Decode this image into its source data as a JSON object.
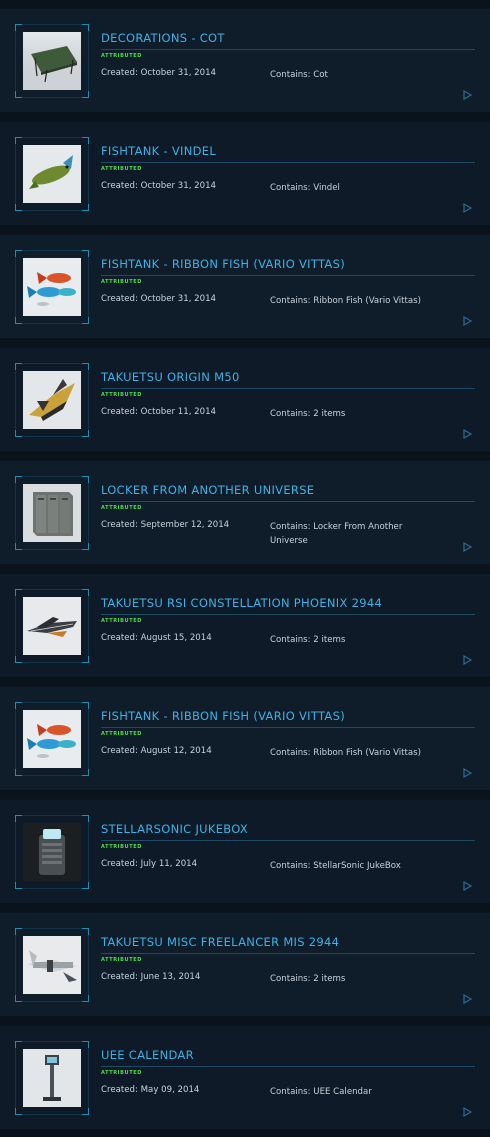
{
  "pledges": [
    {
      "title": "DECORATIONS - COT",
      "tag": "ATTRIBUTED",
      "created": "Created: October 31, 2014",
      "contains": "Contains: Cot",
      "thumb": "cot"
    },
    {
      "title": "FISHTANK - VINDEL",
      "tag": "ATTRIBUTED",
      "created": "Created: October 31, 2014",
      "contains": "Contains: Vindel",
      "thumb": "fish-green"
    },
    {
      "title": "FISHTANK - RIBBON FISH (VARIO VITTAS)",
      "tag": "ATTRIBUTED",
      "created": "Created: October 31, 2014",
      "contains": "Contains: Ribbon Fish (Vario Vittas)",
      "thumb": "fish-ribbon"
    },
    {
      "title": "TAKUETSU ORIGIN M50",
      "tag": "ATTRIBUTED",
      "created": "Created: October 11, 2014",
      "contains": "Contains: 2 items",
      "thumb": "ship-gold"
    },
    {
      "title": "LOCKER FROM ANOTHER UNIVERSE",
      "tag": "ATTRIBUTED",
      "created": "Created: September 12, 2014",
      "contains": "Contains: Locker From Another Universe",
      "thumb": "locker"
    },
    {
      "title": "TAKUETSU RSI CONSTELLATION PHOENIX 2944",
      "tag": "ATTRIBUTED",
      "created": "Created: August 15, 2014",
      "contains": "Contains: 2 items",
      "thumb": "ship-dark"
    },
    {
      "title": "FISHTANK - RIBBON FISH (VARIO VITTAS)",
      "tag": "ATTRIBUTED",
      "created": "Created: August 12, 2014",
      "contains": "Contains: Ribbon Fish (Vario Vittas)",
      "thumb": "fish-ribbon"
    },
    {
      "title": "STELLARSONIC JUKEBOX",
      "tag": "ATTRIBUTED",
      "created": "Created: July 11, 2014",
      "contains": "Contains: StellarSonic JukeBox",
      "thumb": "jukebox"
    },
    {
      "title": "TAKUETSU MISC FREELANCER MIS 2944",
      "tag": "ATTRIBUTED",
      "created": "Created: June 13, 2014",
      "contains": "Contains: 2 items",
      "thumb": "ship-light"
    },
    {
      "title": "UEE CALENDAR",
      "tag": "ATTRIBUTED",
      "created": "Created: May 09, 2014",
      "contains": "Contains: UEE Calendar",
      "thumb": "calendar"
    }
  ],
  "colors": {
    "title": "#39b4e6",
    "tag": "#48e04a",
    "text": "#c8d3dc",
    "frame": "#1e8fb3"
  },
  "icons": {
    "row_action": "play-triangle-icon"
  }
}
